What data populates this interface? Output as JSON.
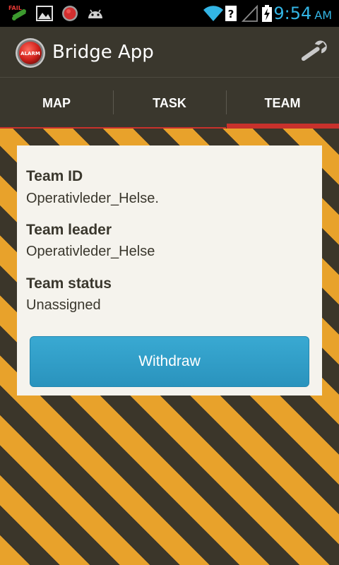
{
  "status_bar": {
    "time": "9:54",
    "ampm": "AM",
    "time_color": "#33b5e5",
    "icons": [
      "fail-notification-icon",
      "image-icon",
      "alarm-icon",
      "android-debug-icon",
      "wifi-icon",
      "data-unknown-icon",
      "signal-icon",
      "battery-charging-icon"
    ],
    "fail_label": "FAIL"
  },
  "action_bar": {
    "title": "Bridge App",
    "logo_label": "ALARM",
    "settings_icon": "wrench-icon"
  },
  "tabs": [
    {
      "label": "MAP",
      "selected": false
    },
    {
      "label": "TASK",
      "selected": false
    },
    {
      "label": "TEAM",
      "selected": true
    }
  ],
  "team_card": {
    "team_id_label": "Team ID",
    "team_id_value": "Operativleder_Helse.",
    "team_leader_label": "Team leader",
    "team_leader_value": "Operativleder_Helse",
    "team_status_label": "Team status",
    "team_status_value": "Unassigned",
    "withdraw_label": "Withdraw"
  },
  "colors": {
    "accent": "#c8312c",
    "button": "#2a93bd",
    "hazard_yellow": "#e8a22b",
    "hazard_dark": "#3b362a"
  }
}
